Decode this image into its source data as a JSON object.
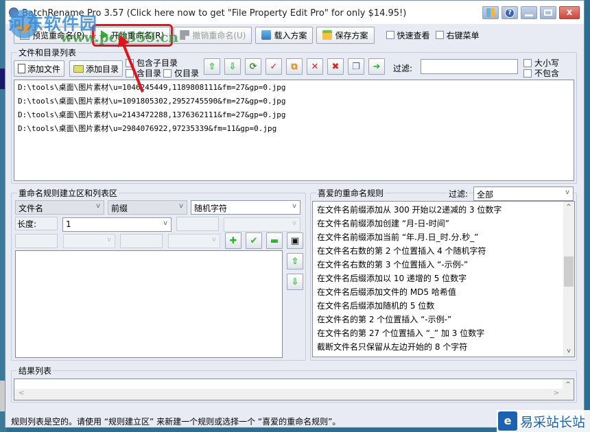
{
  "window": {
    "title": "BatchRename Pro 3.57  (Click here now to get \"File Property Edit Pro\" for only $14.95!)",
    "controls": [
      "cube-icon",
      "help-icon",
      "minimize-icon",
      "maximize-icon",
      "close-icon"
    ],
    "help_glyph": "?",
    "close_glyph": "X"
  },
  "toolbar": {
    "preview_label": "预览重命名(P)",
    "start_label": "开始重命名(R)",
    "undo_label": "撤销重命名(U)",
    "load_label": "载入方案",
    "save_label": "保存方案",
    "quick_view_label": "快速查看",
    "context_menu_label": "右键菜单"
  },
  "files": {
    "group_label": "文件和目录列表",
    "add_file_label": "添加文件",
    "add_dir_label": "添加目录",
    "include_subdir_label": "包含子目录",
    "include_dir_label": "含目录",
    "only_dir_label": "仅目录",
    "filter_label": "过滤:",
    "filter_value": "",
    "case_label": "大小写",
    "exclude_label": "不包含",
    "icon_buttons": [
      "move-up",
      "move-down",
      "refresh",
      "check",
      "duplicate",
      "delete",
      "clear",
      "copy",
      "export"
    ],
    "items": [
      "D:\\tools\\桌面\\图片素材\\u=1046245449,1189808111&fm=27&gp=0.jpg",
      "D:\\tools\\桌面\\图片素材\\u=1091805302,2952745590&fm=27&gp=0.jpg",
      "D:\\tools\\桌面\\图片素材\\u=2143472288,1376362111&fm=27&gp=0.jpg",
      "D:\\tools\\桌面\\图片素材\\u=2984076922,97235339&fm=11&gp=0.jpg"
    ]
  },
  "rules": {
    "group_label": "重命名规则建立区和列表区",
    "target_select": "文件名",
    "position_select": "前缀",
    "type_select": "随机字符",
    "length_label": "长度:",
    "length_value": "1"
  },
  "favorites": {
    "group_label": "喜爱的重命名规则",
    "filter_label": "过滤:",
    "filter_value": "全部",
    "items": [
      "在文件名前缀添加从 300 开始以2递减的 3 位数字",
      "在文件名前缀添加创建 “月-日-时间”",
      "在文件名前缀添加当前 “年.月.日_时.分.秒_”",
      "在文件名右数的第 2 个位置插入 4 个随机字符",
      "在文件名右数的第 3 个位置插入 “-示例-”",
      "在文件名后缀添加以 10 递增的 5 位数字",
      "在文件名后缀添加文件的 MD5 哈希值",
      "在文件名后缀添加随机的 5 位数",
      "在文件名的第 2 个位置插入 “-示例-”",
      "在文件名的第 27 个位置插入 “_” 加 3 位数字",
      "截断文件名只保留从左边开始的 8 个字符"
    ]
  },
  "results": {
    "group_label": "结果列表"
  },
  "status": {
    "message": "规则列表是空的。请使用 “规则建立区” 来新建一个规则或选择一个 “喜爱的重命名规则”。"
  },
  "watermarks": {
    "top_brand": "河东软件园",
    "top_url": "www.pc0359.cn",
    "corner_brand": "易采站长站",
    "corner_mark": "e"
  },
  "scroll_glyphs": {
    "up": "^",
    "down": "v",
    "left": "<",
    "right": ">"
  },
  "chevron": "v"
}
